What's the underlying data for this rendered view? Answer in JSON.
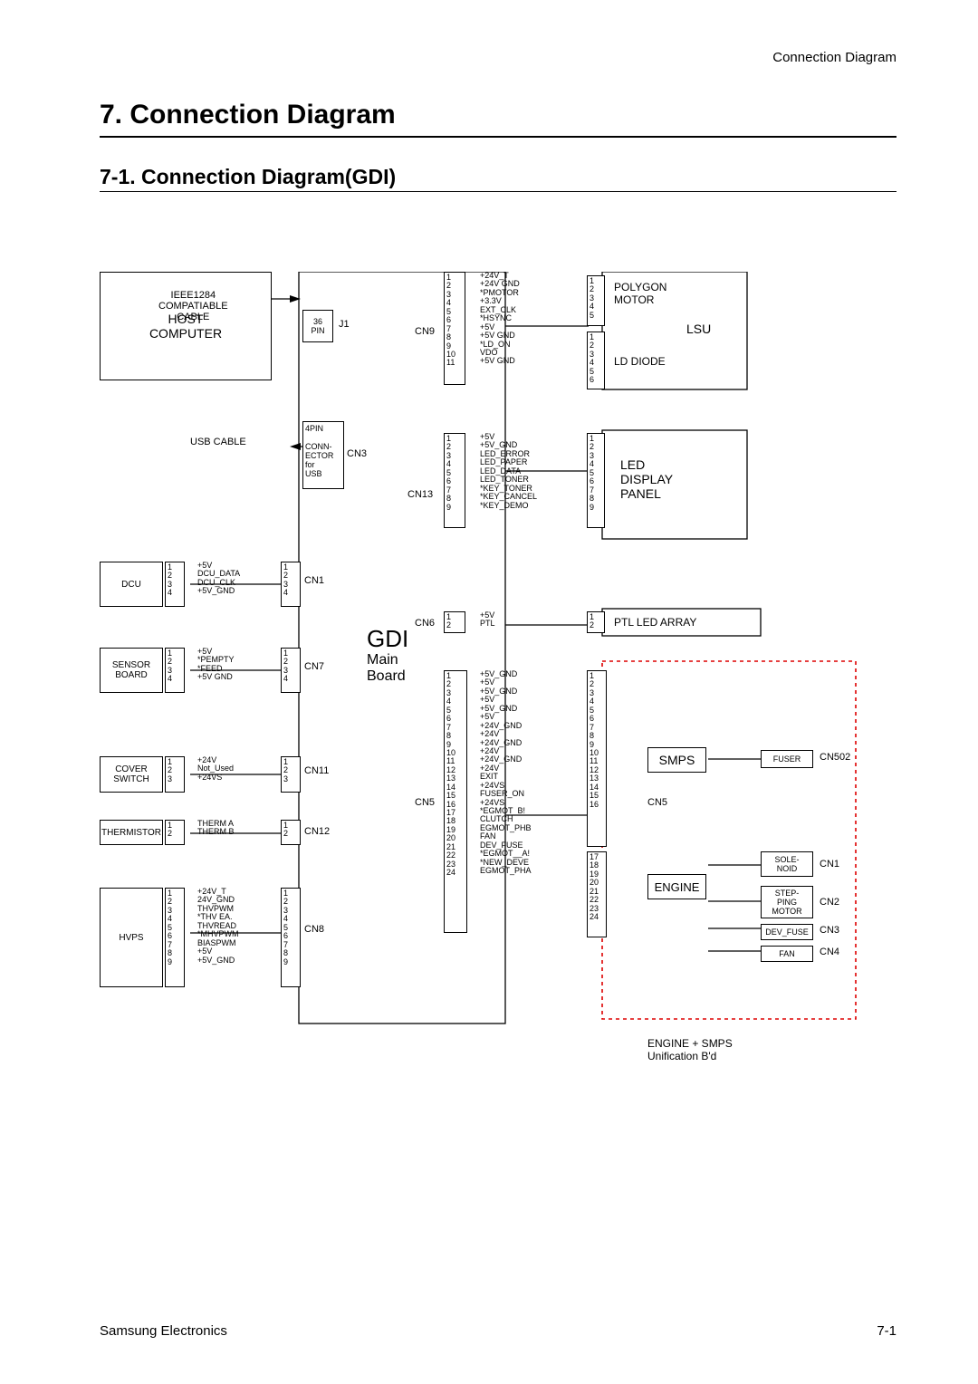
{
  "header": {
    "running": "Connection Diagram",
    "chapter": "7. Connection Diagram",
    "section": "7-1. Connection Diagram(GDI)"
  },
  "footer": {
    "left": "Samsung Electronics",
    "right": "7-1"
  },
  "labels": {
    "host": "HOST\nCOMPUTER",
    "ieee": "IEEE1284\nCOMPATIABLE\nCABLE",
    "usb": "USB CABLE",
    "j1": "J1",
    "pin36": "36\nPIN",
    "conn4": "4PIN\n\nCONN-\nECTOR\nfor\nUSB",
    "cn3": "CN3",
    "dcu": "DCU",
    "sensor": "SENSOR\nBOARD",
    "cover": "COVER\nSWITCH",
    "therm": "THERMISTOR",
    "hvps": "HVPS",
    "gdi": "GDI",
    "main": "Main\nBoard",
    "polygon": "POLYGON\nMOTOR",
    "lsu": "LSU",
    "ldd": "LD DIODE",
    "led": "LED\nDISPLAY\nPANEL",
    "ptl": "PTL LED ARRAY",
    "smps": "SMPS",
    "engine": "ENGINE",
    "fuserlbl": "FUSER",
    "solenoid": "SOLE-\nNOID",
    "stepmotor": "STEP-\nPING\nMOTOR",
    "devfuse": "DEV_FUSE",
    "fan": "FAN",
    "unif": "ENGINE + SMPS\nUnification B'd"
  },
  "signals": {
    "cn9": [
      "+24V_T",
      "+24V GND",
      "*PMOTOR",
      "+3.3V",
      "EXT_CLK",
      "*HSYNC",
      "+5V",
      "+5V GND",
      "*LD_ON",
      "VDO",
      "+5V GND"
    ],
    "cn13": [
      "+5V",
      "+5V_GND",
      "LED_ERROR",
      "LED_PAPER",
      "LED_DATA",
      "LED_TONER",
      "*KEY_TONER",
      "*KEY_CANCEL",
      "*KEY_DEMO"
    ],
    "cn6": [
      "+5V",
      "PTL"
    ],
    "cn1": [
      "+5V",
      "DCU_DATA",
      "DCU_CLK",
      "+5V_GND"
    ],
    "cn7": [
      "+5V",
      "*PEMPTY",
      "*FEED",
      "+5V GND"
    ],
    "cn11": [
      "+24V",
      "Not_Used",
      "+24VS"
    ],
    "cn12": [
      "THERM A",
      "THERM B"
    ],
    "cn8": [
      "+24V_T",
      "24V_GND",
      "THVPWM",
      "*THV EA.",
      "THVREAD",
      "*MHVPWM",
      "BIASPWM",
      "+5V",
      "+5V_GND"
    ],
    "cn5": [
      "+5V_GND",
      "+5V",
      "+5V_GND",
      "+5V",
      "+5V_GND",
      "+5V",
      "+24V_GND",
      "+24V",
      "+24V_GND",
      "+24V",
      "+24V_GND",
      "+24V",
      "EXIT",
      "+24VS",
      "FUSER_ON",
      "+24VS",
      "*EGMOT_B!",
      "CLUTCH",
      "EGMOT_PHB",
      "FAN",
      "DEV_FUSE",
      "*EGMOT__A!",
      "*NEW_DEVE",
      "EGMOT_PHA"
    ]
  },
  "conns": {
    "cn9": "CN9",
    "cn13": "CN13",
    "cn6": "CN6",
    "cn1": "CN1",
    "cn7": "CN7",
    "cn11": "CN11",
    "cn12": "CN12",
    "cn8": "CN8",
    "cn5_l": "CN5",
    "cn5_r": "CN5",
    "cn1r": "CN1",
    "cn2r": "CN2",
    "cn3r": "CN3",
    "cn4r": "CN4",
    "cn502": "CN502"
  },
  "pincounts": {
    "p11": "1\n2\n3\n4\n5\n6\n7\n8\n9\n10\n11",
    "p9": "1\n2\n3\n4\n5\n6\n7\n8\n9",
    "p2": "1\n2",
    "p4": "1\n2\n3\n4",
    "p3": "1\n2\n3",
    "p5": "1\n2\n3\n4\n5",
    "p6": "1\n2\n3\n4\n5\n6",
    "p16": "1\n2\n3\n4\n5\n6\n7\n8\n9\n10\n11\n12\n13\n14\n15\n16",
    "p17_24": "17\n18\n19\n20\n21\n22\n23\n24",
    "p24": "1\n2\n3\n4\n5\n6\n7\n8\n9\n10\n11\n12\n13\n14\n15\n16\n17\n18\n19\n20\n21\n22\n23\n24"
  }
}
